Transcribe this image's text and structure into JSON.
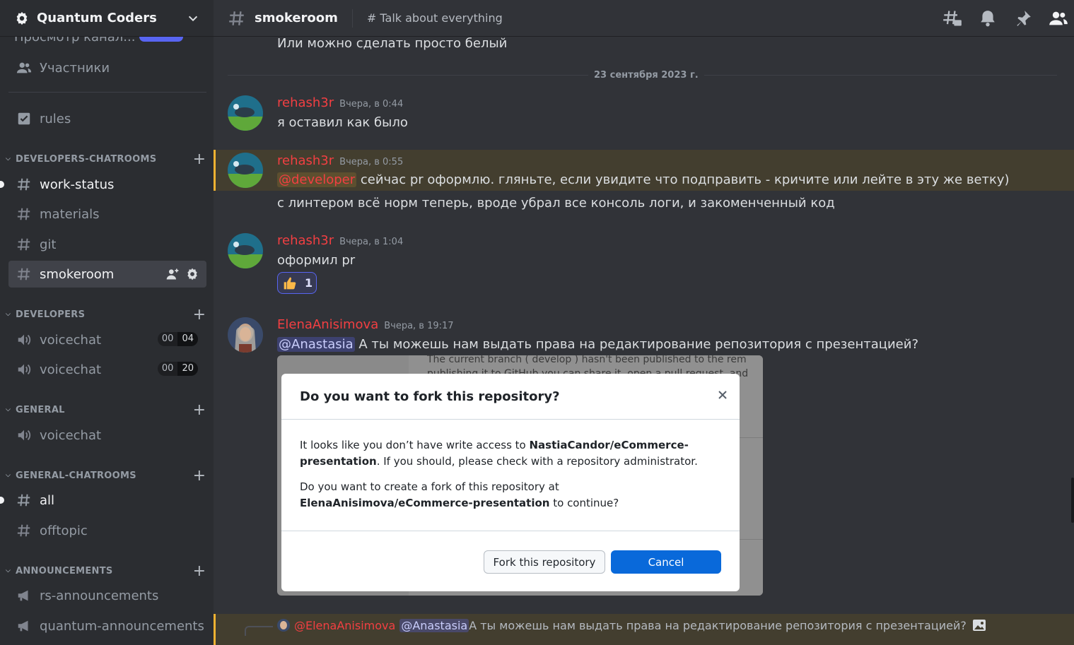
{
  "server": {
    "name": "Quantum Coders"
  },
  "sidebar": {
    "clipped_item": "Просмотр канал...",
    "members_label": "Участники",
    "rules_label": "rules",
    "categories": [
      {
        "label": "DEVELOPERS-CHATROOMS"
      },
      {
        "label": "DEVELOPERS"
      },
      {
        "label": "GENERAL"
      },
      {
        "label": "GENERAL-CHATROOMS"
      },
      {
        "label": "ANNOUNCEMENTS"
      }
    ],
    "channels": {
      "work_status": "work-status",
      "materials": "materials",
      "git": "git",
      "smokeroom": "smokeroom",
      "voicechat1": {
        "label": "voicechat",
        "a": "00",
        "b": "04"
      },
      "voicechat2": {
        "label": "voicechat",
        "a": "00",
        "b": "20"
      },
      "voicechat3": "voicechat",
      "all": "all",
      "offtopic": "offtopic",
      "rs_announcements": "rs-announcements",
      "quantum_announcements": "quantum-announcements"
    }
  },
  "topbar": {
    "channel": "smokeroom",
    "topic": "# Talk about everything"
  },
  "chat": {
    "prev_text": "Или можно сделать просто белый",
    "date_divider": "23 сентября 2023 г.",
    "messages": [
      {
        "author": "rehash3r",
        "time": "Вчера, в 0:44",
        "text": "я оставил как было"
      },
      {
        "author": "rehash3r",
        "time": "Вчера, в 0:55",
        "mention": "@developer",
        "text": " сейчас pr оформлю. гляньте, если увидите что подправить - кричите или лейте в эту же ветку)",
        "followup": "с линтером всё норм теперь, вроде убрал все консоль логи, и закоменченный код"
      },
      {
        "author": "rehash3r",
        "time": "Вчера, в 1:04",
        "text": "оформил pr",
        "reaction_count": "1"
      },
      {
        "author": "ElenaAnisimova",
        "time": "Вчера, в 19:17",
        "mention": "@Anastasia",
        "text": " А ты можешь нам выдать права на редактирование репозитория с презентацией?"
      }
    ],
    "reply_preview": {
      "author": "@ElenaAnisimova",
      "mention": "@Anastasia",
      "text": " А ты можешь нам выдать права на редактирование репозитория с презентацией?"
    }
  },
  "attachment": {
    "bg_line1": "The current branch ( develop ) hasn't been published to the rem",
    "bg_line2": "publishing it to GitHub you can share it, open a pull request, and",
    "dialog": {
      "title": "Do you want to fork this repository?",
      "p1_a": "It looks like you don’t have write access to ",
      "p1_repo": "NastiaCandor/eCommerce-presentation",
      "p1_b": ". If you should, please check with a repository administrator.",
      "p2_a": "Do you want to create a fork of this repository at ",
      "p2_repo": "ElenaAnisimova/eCommerce-presentation",
      "p2_b": " to continue?",
      "fork_button": "Fork this repository",
      "cancel_button": "Cancel"
    }
  },
  "colors": {
    "accent": "#5865f2",
    "author": "#f23f42",
    "mention_highlight": "#f0b232",
    "github_blue": "#0969da"
  }
}
